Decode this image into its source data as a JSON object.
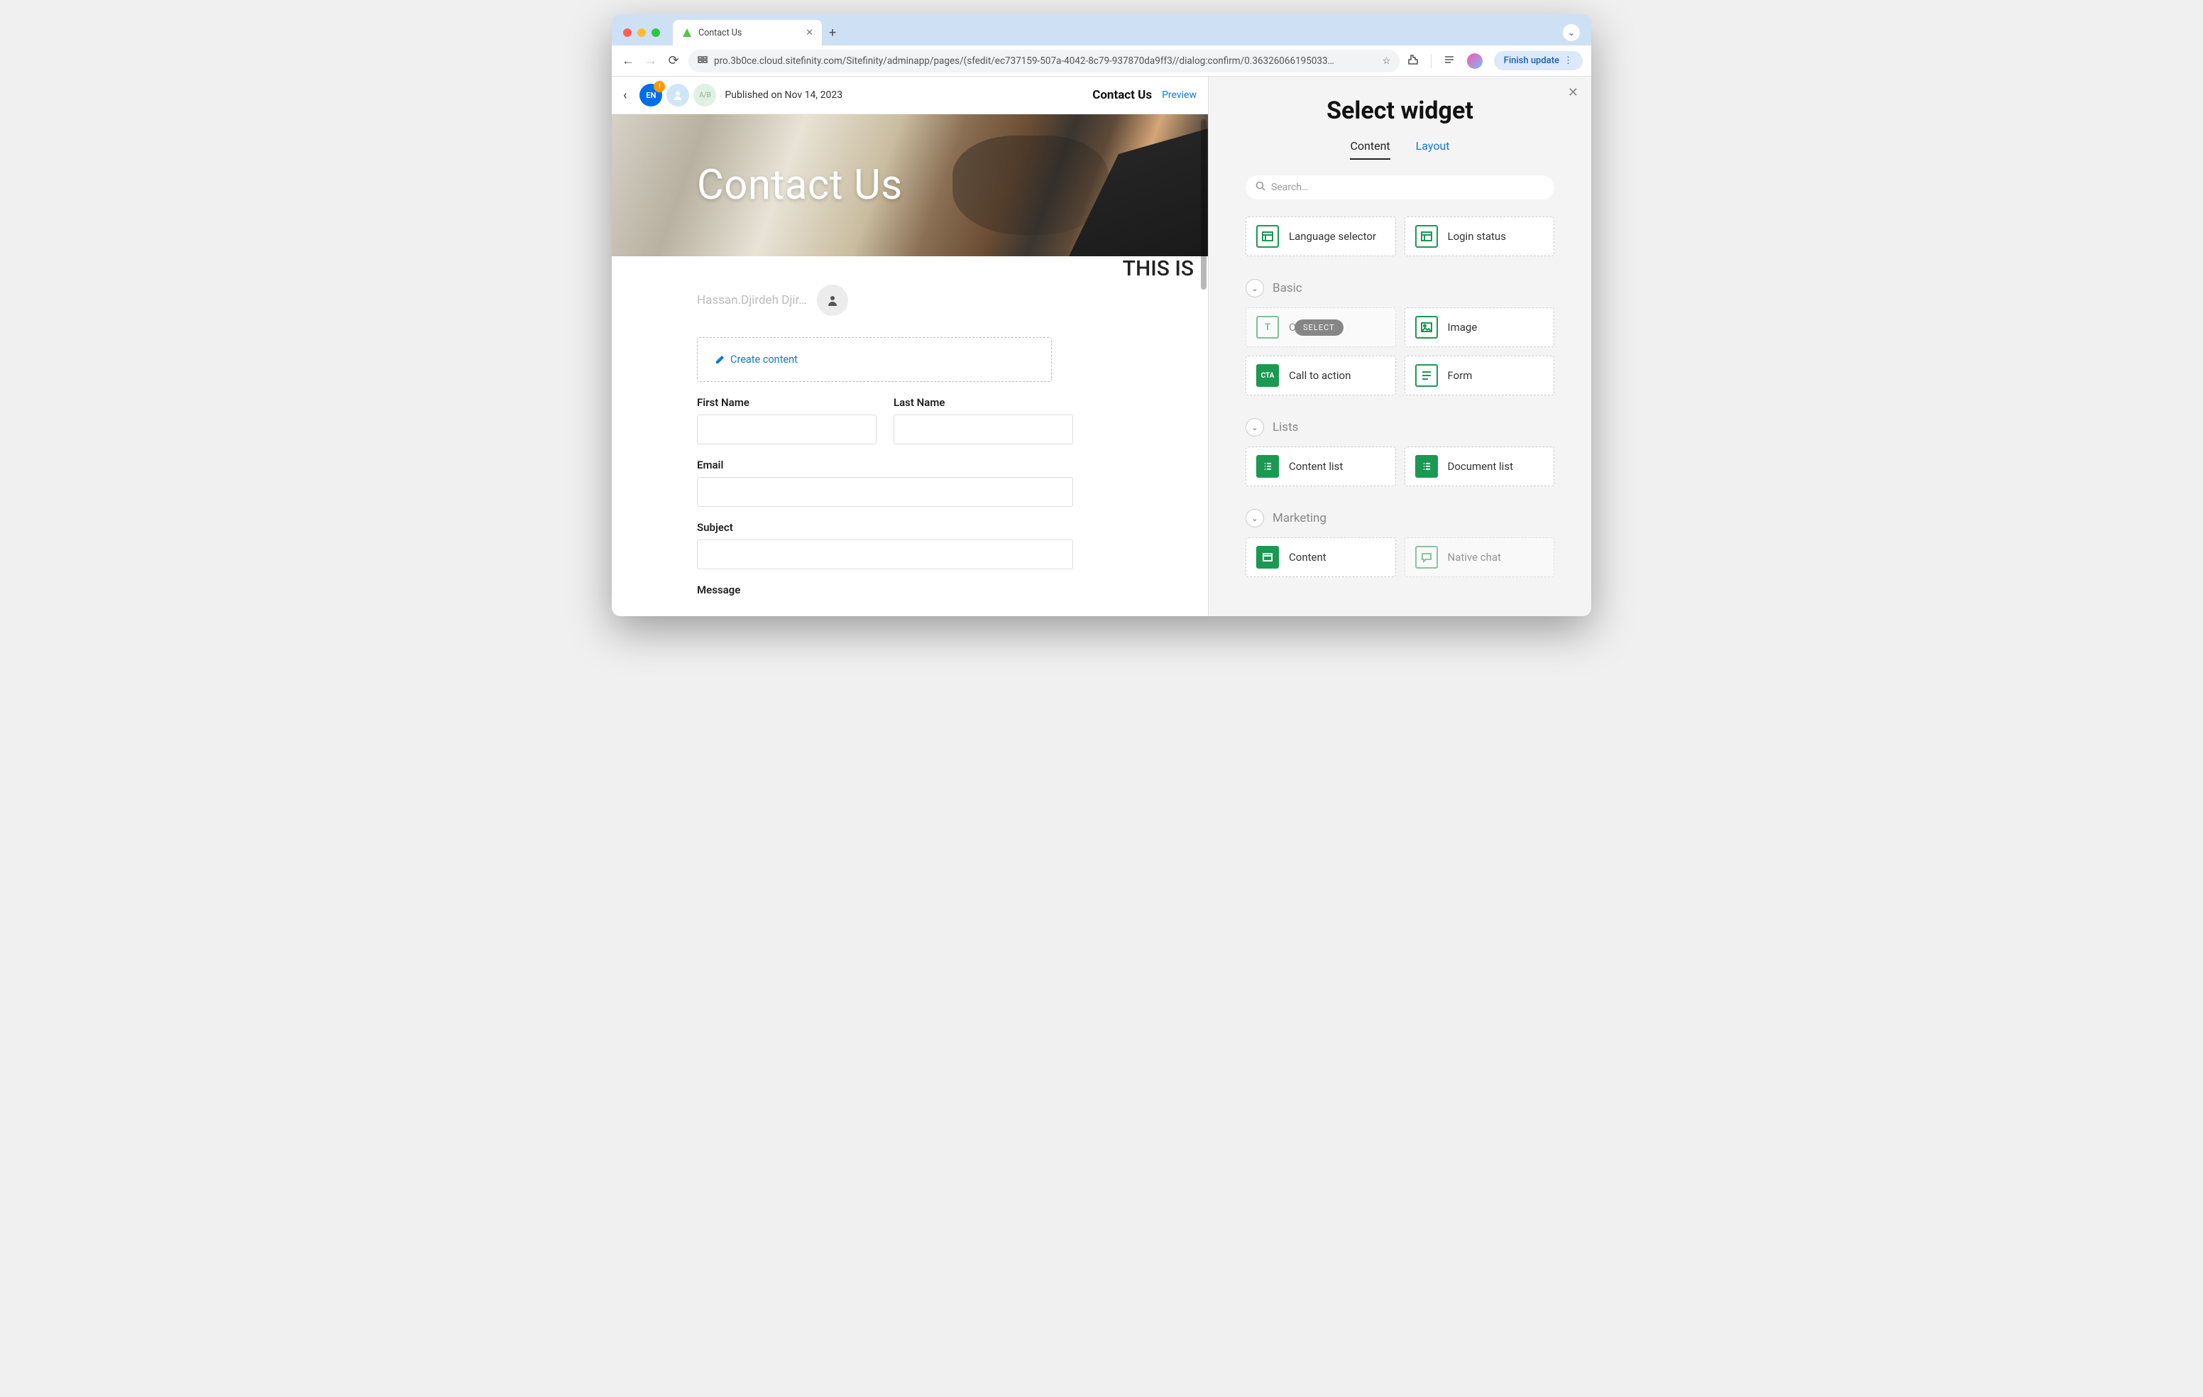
{
  "browser": {
    "tab_title": "Contact Us",
    "url": "pro.3b0ce.cloud.sitefinity.com/Sitefinity/adminapp/pages/(sfedit/ec737159-507a-4042-8c79-937870da9ff3//dialog:confirm/0.36326066195033…",
    "update_button": "Finish update"
  },
  "header": {
    "lang_badge": "EN",
    "notif": "!",
    "ab_badge": "A/B",
    "published_text": "Published on Nov 14, 2023",
    "page_title": "Contact Us",
    "preview": "Preview"
  },
  "hero": {
    "title": "Contact Us"
  },
  "body": {
    "author": "Hassan.Djirdeh Djir…",
    "this_is": "THIS IS",
    "create_content": "Create content",
    "form": {
      "first_name": "First Name",
      "last_name": "Last Name",
      "email": "Email",
      "subject": "Subject",
      "message": "Message"
    }
  },
  "panel": {
    "title": "Select widget",
    "tabs": {
      "content": "Content",
      "layout": "Layout"
    },
    "search_placeholder": "Search…",
    "select_pill": "SELECT",
    "sections": {
      "top": [
        {
          "label": "Language selector"
        },
        {
          "label": "Login status"
        }
      ],
      "basic": {
        "name": "Basic",
        "items": [
          {
            "label": "Content block",
            "label_truncated": "Co        ck"
          },
          {
            "label": "Image"
          },
          {
            "label": "Call to action"
          },
          {
            "label": "Form"
          }
        ]
      },
      "lists": {
        "name": "Lists",
        "items": [
          {
            "label": "Content list"
          },
          {
            "label": "Document list"
          }
        ]
      },
      "marketing": {
        "name": "Marketing",
        "items": [
          {
            "label": "Content"
          },
          {
            "label": "Native chat"
          }
        ]
      }
    }
  }
}
